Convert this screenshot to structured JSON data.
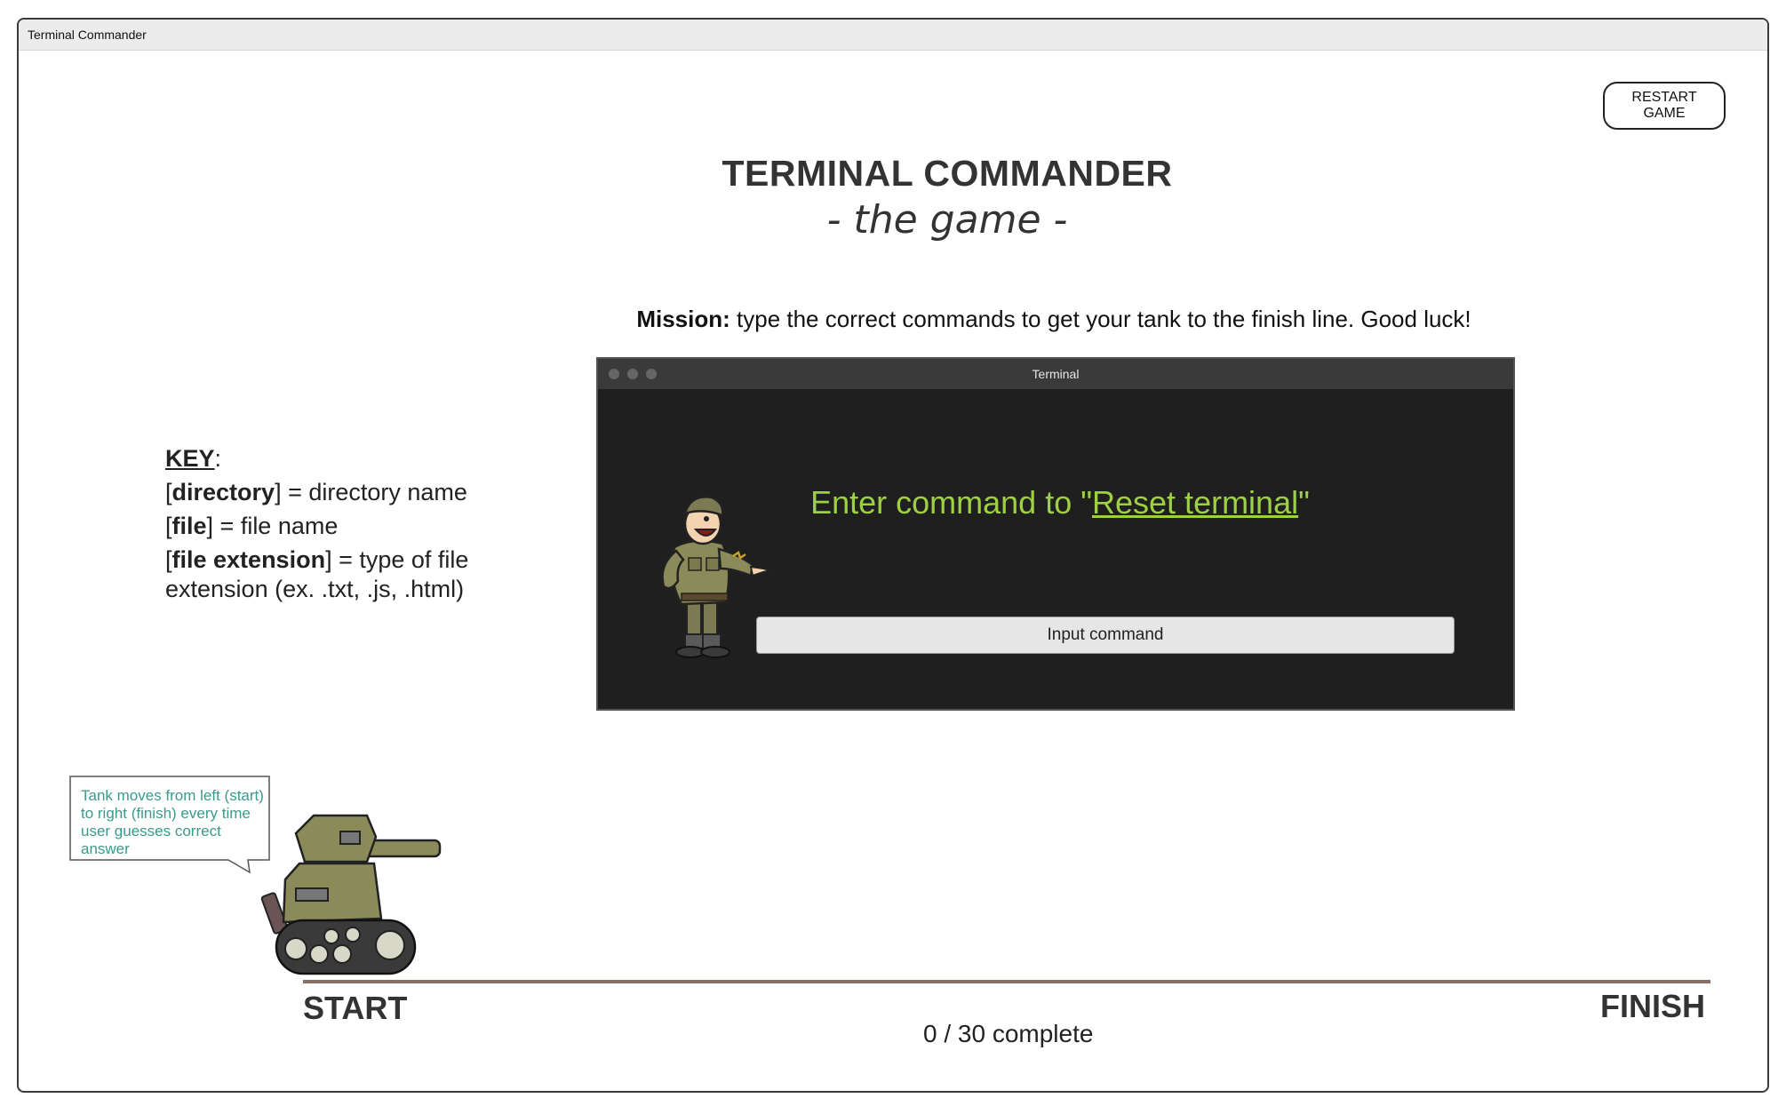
{
  "window": {
    "title": "Terminal Commander"
  },
  "header": {
    "restart_label": "RESTART GAME",
    "title": "TERMINAL COMMANDER",
    "subtitle": "- the game -"
  },
  "mission": {
    "label": "Mission:",
    "text": " type the correct commands to get your tank to the finish line. Good luck!"
  },
  "key": {
    "title": "KEY",
    "items": [
      {
        "term": "directory",
        "desc": "directory name"
      },
      {
        "term": "file",
        "desc": "file name"
      },
      {
        "term": "file extension",
        "desc": "type of file",
        "desc2": "extension (ex. .txt, .js, .html)"
      }
    ]
  },
  "terminal": {
    "title": "Terminal",
    "prompt_prefix": "Enter command to \"",
    "prompt_task": "Reset terminal",
    "prompt_suffix": "\"",
    "prompt_color": "#9ed043",
    "input_placeholder": "Input command"
  },
  "track": {
    "callout": "Tank moves from left (start) to right (finish) every time user guesses correct answer",
    "start_label": "START",
    "finish_label": "FINISH",
    "completed": 0,
    "total": 30,
    "progress_text": "0 / 30 complete"
  },
  "icons": [
    "soldier-illustration",
    "tank-illustration",
    "window-dot-icon"
  ]
}
